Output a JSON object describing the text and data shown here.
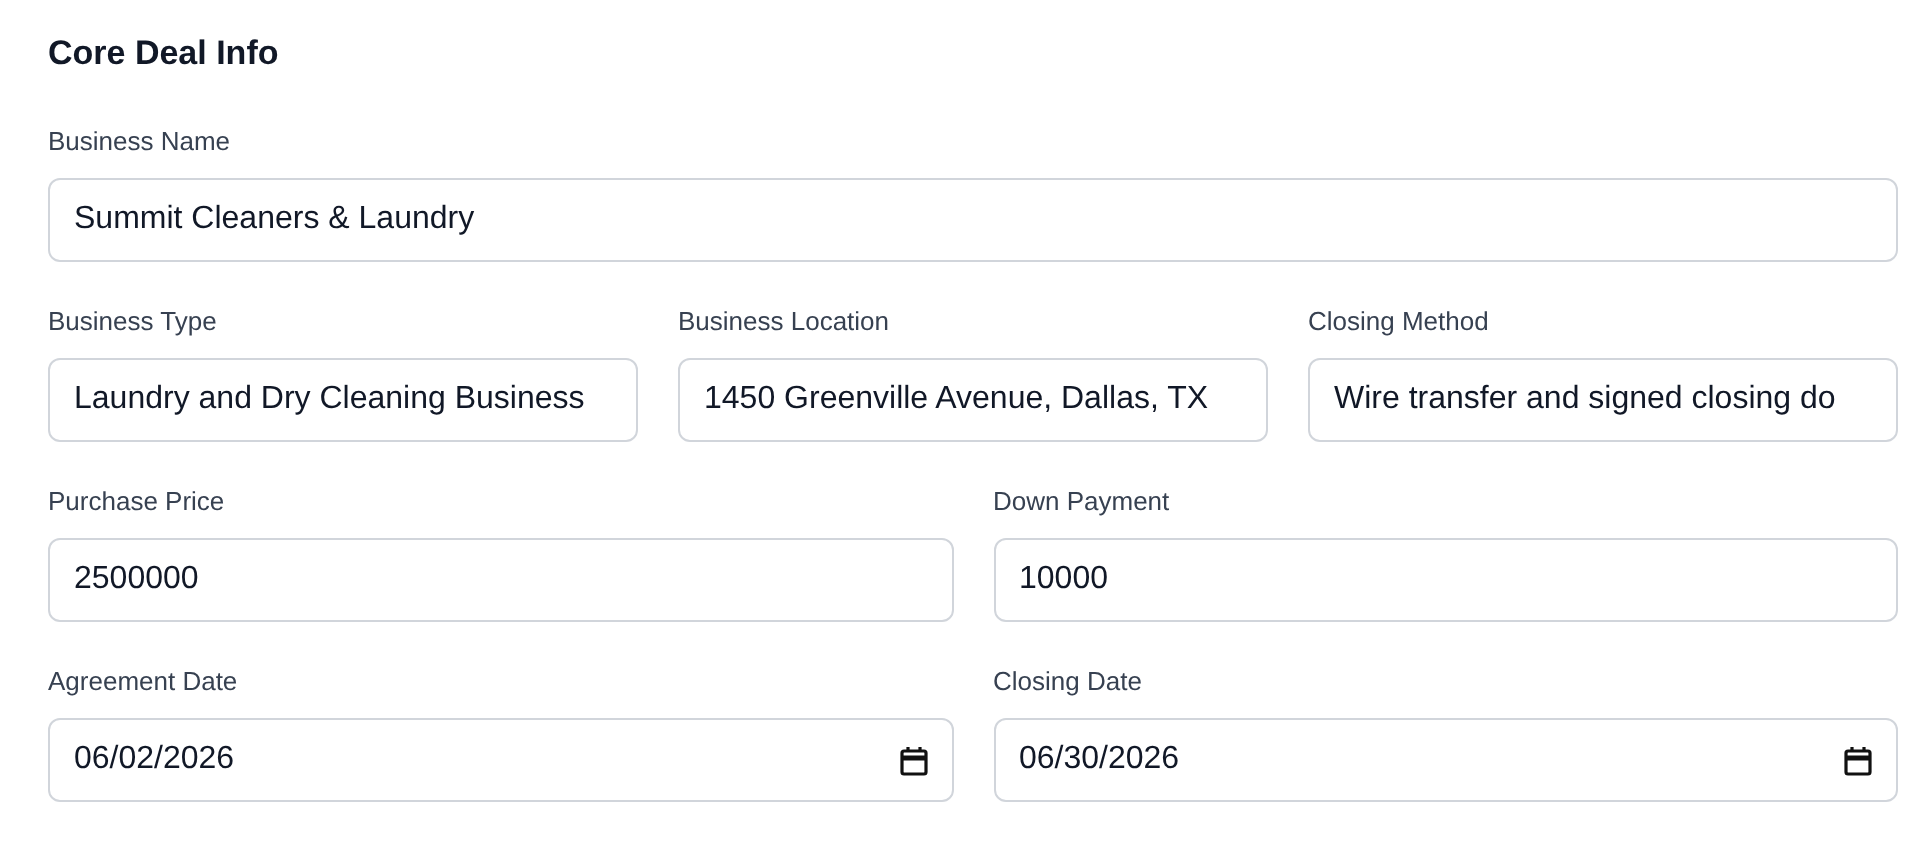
{
  "section": {
    "title": "Core Deal Info"
  },
  "rows": [
    {
      "fields": [
        {
          "label": "Business Name",
          "value": "Summit Cleaners & Laundry",
          "kind": "text"
        }
      ]
    },
    {
      "fields": [
        {
          "label": "Business Type",
          "value": "Laundry and Dry Cleaning Business",
          "kind": "text"
        },
        {
          "label": "Business Location",
          "value": "1450 Greenville Avenue, Dallas, TX",
          "kind": "text"
        },
        {
          "label": "Closing Method",
          "value": "Wire transfer and signed closing do",
          "kind": "text"
        }
      ]
    },
    {
      "fields": [
        {
          "label": "Purchase Price",
          "value": "2500000",
          "kind": "text"
        },
        {
          "label": "Down Payment",
          "value": "10000",
          "kind": "text"
        }
      ]
    },
    {
      "fields": [
        {
          "label": "Agreement Date",
          "value": "06/02/2026",
          "kind": "date"
        },
        {
          "label": "Closing Date",
          "value": "06/30/2026",
          "kind": "date"
        }
      ]
    }
  ]
}
